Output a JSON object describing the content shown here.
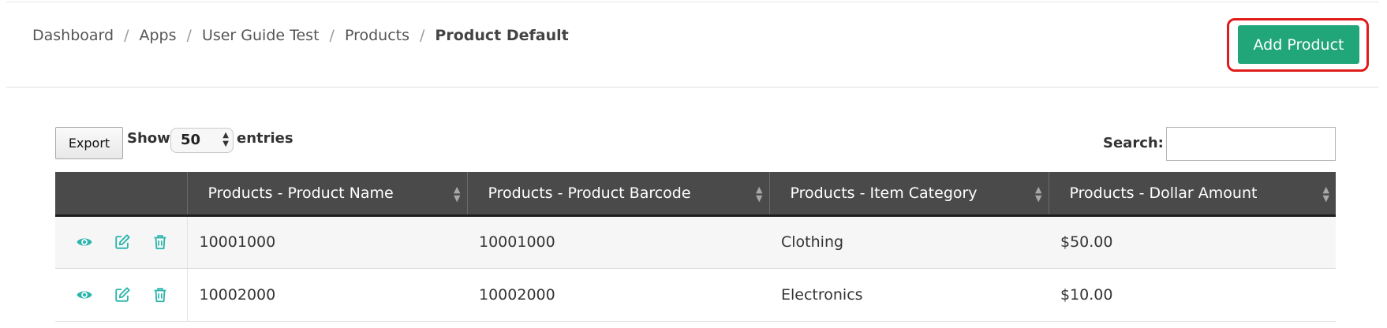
{
  "breadcrumb": {
    "items": [
      "Dashboard",
      "Apps",
      "User Guide Test",
      "Products"
    ],
    "current": "Product Default",
    "separator": "/"
  },
  "header": {
    "add_button_label": "Add Product"
  },
  "toolbar": {
    "export_label": "Export",
    "show_label": "Show",
    "entries_value": "50",
    "entries_label": "entries",
    "search_label": "Search:",
    "search_value": ""
  },
  "table": {
    "columns": [
      "Products - Product Name",
      "Products - Product Barcode",
      "Products - Item Category",
      "Products - Dollar Amount"
    ],
    "rows": [
      [
        "10001000",
        "10001000",
        "Clothing",
        "$50.00"
      ],
      [
        "10002000",
        "10002000",
        "Electronics",
        "$10.00"
      ]
    ],
    "row_actions": [
      "view-icon",
      "edit-icon",
      "delete-icon"
    ]
  },
  "colors": {
    "accent": "#21a67a",
    "highlight": "#e01b1b",
    "icon": "#2bb5ad",
    "table_header": "#4a4a4a"
  }
}
